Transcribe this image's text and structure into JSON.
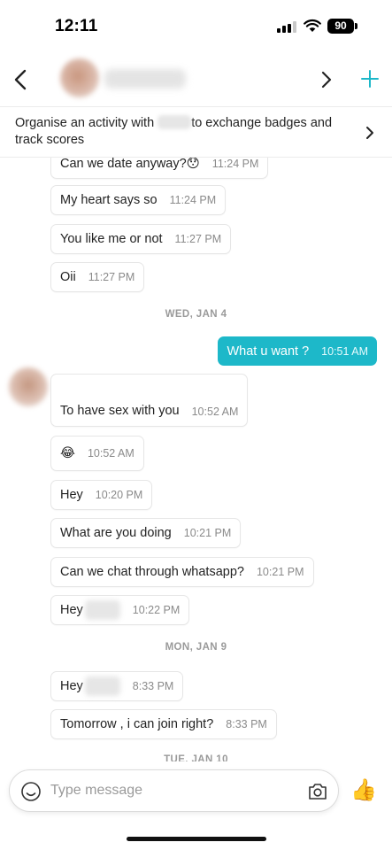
{
  "status_bar": {
    "time": "12:11",
    "battery": "90"
  },
  "header": {
    "back_icon": "chevron-left-icon",
    "next_icon": "chevron-right-icon",
    "add_icon": "plus-icon",
    "accent_color": "#1db8c9"
  },
  "banner": {
    "text_before": "Organise an activity with ",
    "text_after": "to exchange badges and track scores"
  },
  "messages": [
    {
      "text": "Can we date anyway?😯",
      "time": "11:24 PM"
    },
    {
      "text": "My heart says so",
      "time": "11:24 PM"
    },
    {
      "text": "You like me or not",
      "time": "11:27 PM"
    },
    {
      "text": "Oii",
      "time": "11:27 PM"
    },
    {
      "text": "What u want ?",
      "time": "10:51 AM"
    },
    {
      "text": "To have sex with you",
      "time": "10:52 AM"
    },
    {
      "text": "😂",
      "time": "10:52 AM"
    },
    {
      "text": "Hey",
      "time": "10:20 PM"
    },
    {
      "text": "What are you doing",
      "time": "10:21 PM"
    },
    {
      "text": "Can we chat through whatsapp?",
      "time": "10:21 PM"
    },
    {
      "text": "Hey",
      "time": "10:22 PM"
    },
    {
      "text": "Hey",
      "time": "8:33 PM"
    },
    {
      "text": "Tomorrow , i can join right?",
      "time": "8:33 PM"
    }
  ],
  "dates": [
    "WED, JAN 4",
    "MON, JAN 9",
    "TUE, JAN 10"
  ],
  "input": {
    "placeholder": "Type message",
    "value": ""
  },
  "icons": {
    "emoji": "smiley-icon",
    "camera": "camera-icon",
    "like": "thumbs-up-icon"
  },
  "like_emoji": "👍"
}
